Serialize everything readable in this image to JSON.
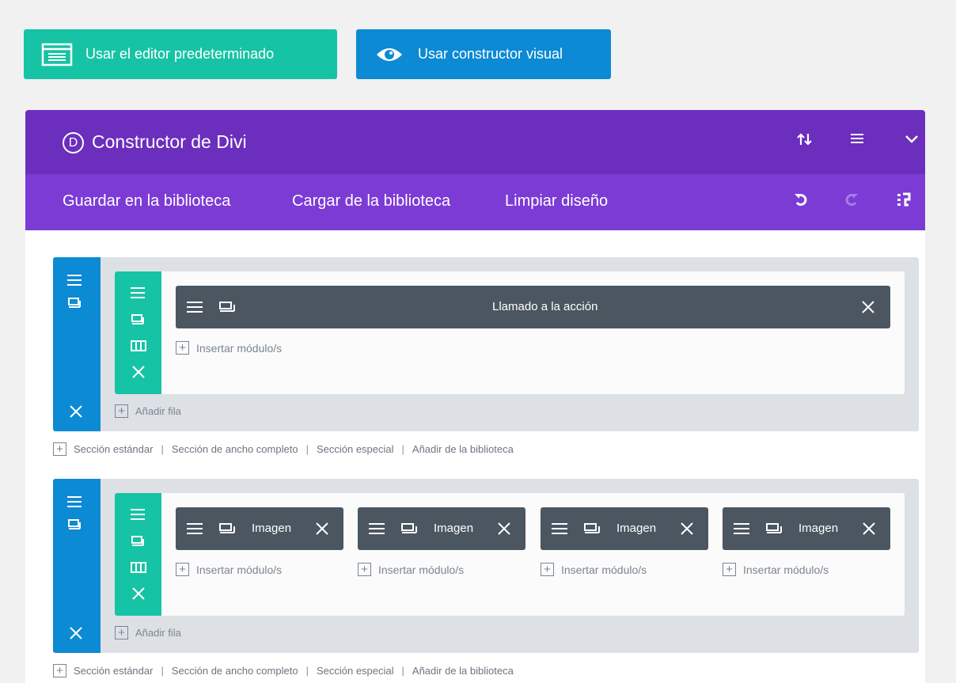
{
  "top_buttons": {
    "default_editor": "Usar el editor predeterminado",
    "visual_builder": "Usar constructor visual"
  },
  "builder": {
    "logo_letter": "D",
    "title": "Constructor de Divi",
    "toolbar": {
      "save_library": "Guardar en la biblioteca",
      "load_library": "Cargar de la biblioteca",
      "clear_layout": "Limpiar diseño"
    }
  },
  "sections": [
    {
      "modules": [
        {
          "label": "Llamado a la acción"
        }
      ],
      "insert_labels": [
        "Insertar módulo/s"
      ],
      "add_row": "Añadir fila"
    },
    {
      "modules": [
        {
          "label": "Imagen"
        },
        {
          "label": "Imagen"
        },
        {
          "label": "Imagen"
        },
        {
          "label": "Imagen"
        }
      ],
      "insert_labels": [
        "Insertar módulo/s",
        "Insertar módulo/s",
        "Insertar módulo/s",
        "Insertar módulo/s"
      ],
      "add_row": "Añadir fila"
    }
  ],
  "section_links": {
    "standard": "Sección estándar",
    "fullwidth": "Sección de ancho completo",
    "special": "Sección especial",
    "library": "Añadir de la biblioteca",
    "separator": "|"
  },
  "colors": {
    "teal": "#17c3a5",
    "blue": "#0c8ad4",
    "purple_header": "#6c2ebd",
    "purple_toolbar": "#7c3bd5",
    "module_dark": "#4b5661"
  },
  "icons": [
    "document-icon",
    "eye-icon",
    "sort-icon",
    "menu-icon",
    "chevron-down-icon",
    "undo-icon",
    "redo-icon",
    "portability-icon",
    "hamburger-icon",
    "duplicate-icon",
    "columns-icon",
    "close-icon",
    "plus-icon"
  ]
}
